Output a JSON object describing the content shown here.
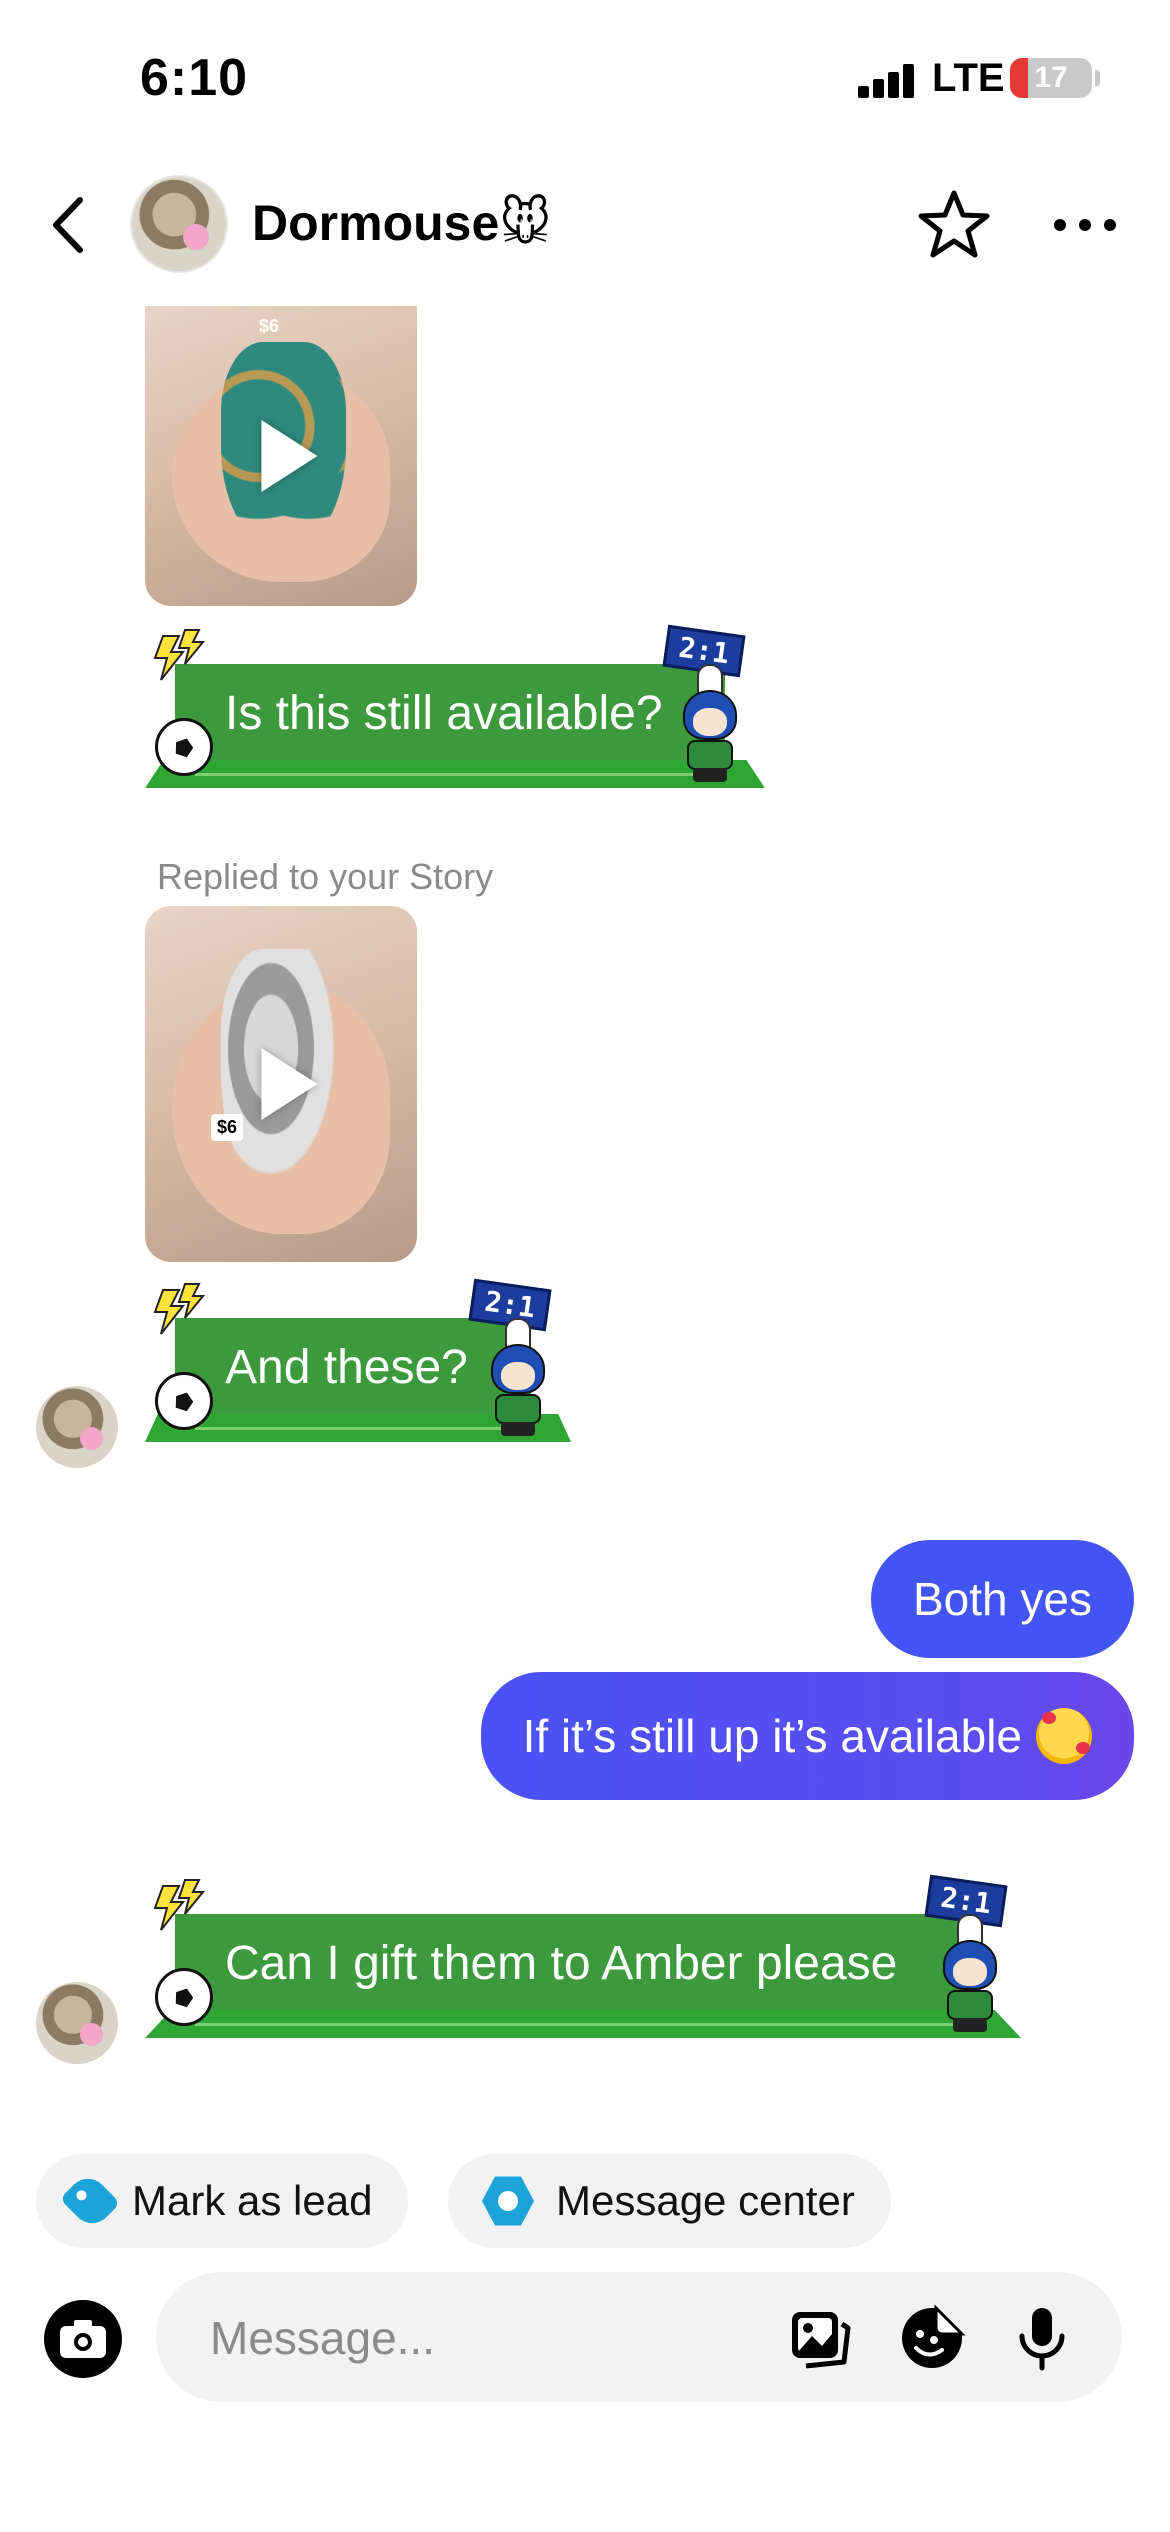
{
  "status_bar": {
    "time": "6:10",
    "network": "LTE",
    "battery_level": "17",
    "battery_color": "#e53935"
  },
  "header": {
    "back_icon": "chevron-left-icon",
    "contact_name": "Dormouse🐭",
    "star_icon": "star-outline-icon",
    "more_icon": "more-horizontal-icon"
  },
  "messages": {
    "story_price_1": "$6",
    "msg_1": "Is this still available?",
    "replied_label": "Replied to your Story",
    "story_price_2": "$6",
    "msg_2": "And these?",
    "sent_1": "Both yes",
    "sent_2": "If it’s still up it’s available",
    "sent_2_emoji": "smiling-face-with-hearts",
    "msg_3": "Can I gift them to Amber please",
    "sticker_score": "2:1"
  },
  "quick_actions": {
    "mark_as_lead": "Mark as lead",
    "message_center": "Message center",
    "accent_color": "#1ca3d8"
  },
  "composer": {
    "placeholder": "Message...",
    "camera_icon": "camera-icon",
    "gallery_icon": "gallery-icon",
    "sticker_icon": "sticker-icon",
    "mic_icon": "microphone-icon"
  },
  "colors": {
    "sent_bubble": "#4255f2",
    "received_bubble": "#3c9a3d"
  }
}
